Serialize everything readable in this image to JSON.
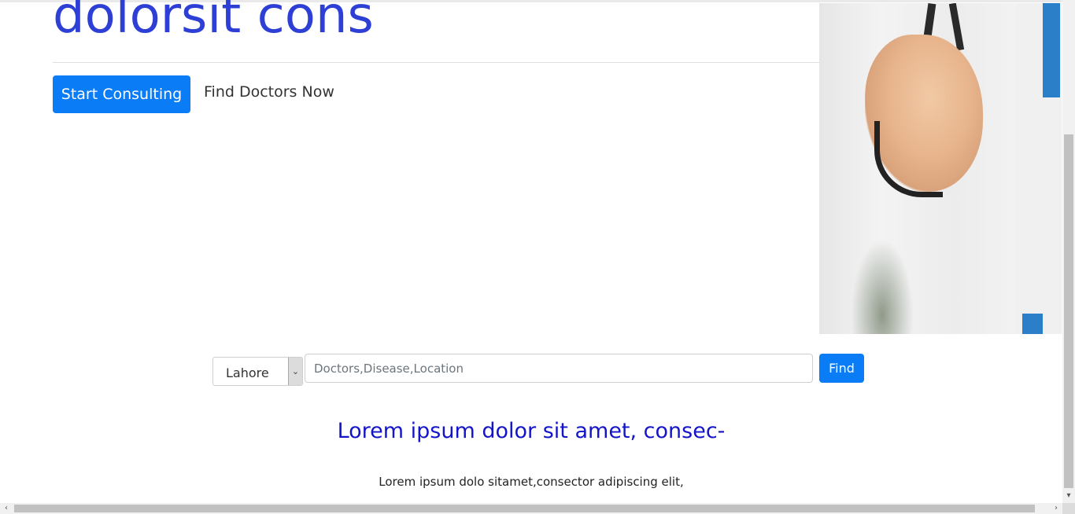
{
  "hero": {
    "title": "dolorsit cons",
    "start_button_label": "Start Consulting",
    "find_doctors_label": "Find Doctors Now"
  },
  "search": {
    "city_value": "Lahore",
    "input_placeholder": "Doctors,Disease,Location",
    "find_button_label": "Find"
  },
  "section": {
    "title": "Lorem ipsum dolor sit amet, consec-",
    "subtitle": "Lorem ipsum dolo sitamet,consector adipiscing elit,"
  },
  "icons": {
    "select_arrow": "chevron-down-icon",
    "scroll_down": "chevron-down-icon",
    "scroll_left": "chevron-left-icon",
    "scroll_right": "chevron-right-icon"
  },
  "colors": {
    "title_blue": "#2e3fd6",
    "primary_button": "#0a7cf5",
    "section_title": "#1414c9"
  }
}
